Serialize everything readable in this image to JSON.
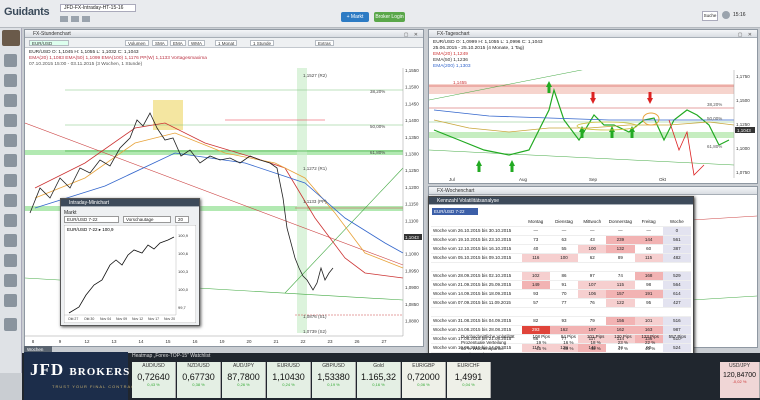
{
  "app": {
    "logo_text": "Guidants",
    "tab_title": "JFD-FX-Intraday-HT-15-16",
    "btn_markt": "+ Markt",
    "btn_broker": "Broker Login",
    "search": "Suche",
    "time": "15:16"
  },
  "main_chart": {
    "title": "FX-Stundenchart",
    "toolbar": [
      "Volumen",
      "SMA",
      "EMA",
      "WMA",
      "1 Monat",
      "1 Stunde",
      "Extras"
    ],
    "symbol_line": "EUR/USD  O: 1,1045  H: 1,1055  L: 1,1032  C: 1,1043",
    "ema_line": "EMA(20) 1,1083   EMA(50) 1,1099   EMA(100) 1,1176   PP(W) 1,1133   Vortagesmaxima",
    "date_line": "07.10.2015 15:00 - 03.11.2015 (3 Wochen, 1 Stunde)",
    "price_ticks": [
      "1,1550",
      "1,1500",
      "1,1450",
      "1,1400",
      "1,1350",
      "1,1300",
      "1,1250",
      "1,1200",
      "1,1150",
      "1,1100",
      "1,1050",
      "1,1000",
      "1,0950",
      "1,0900",
      "1,0850",
      "1,0800"
    ],
    "date_ticks": [
      "8",
      "9",
      "12",
      "13",
      "14",
      "15",
      "16",
      "19",
      "20",
      "21",
      "22",
      "23",
      "26",
      "27"
    ],
    "level_labels": [
      "1,1527 (R2)",
      "38,20%",
      "50,00%",
      "61,80%",
      "1,1272 (R1)",
      "1,1133 (PP)",
      "1,1043",
      "1,0876 (S1)",
      "1,0739 (S2)"
    ],
    "last_price": "1,1043"
  },
  "mini_chart": {
    "title": "Intraday-Minichart",
    "search_label": "Markt",
    "symbol": "EUR/USD 7-22",
    "dropdown": "Vorschautage",
    "days": "20",
    "header": "EUR/USD 7-22 ▸ 100,9",
    "ticks_y": [
      "100,9",
      "100,6",
      "100,3",
      "100,0",
      "99,7"
    ],
    "ticks_x": [
      "Okt 27",
      "Okt 30",
      "Nov 04",
      "Nov 09",
      "Nov 12",
      "Nov 17",
      "Nov 20"
    ]
  },
  "daily_chart": {
    "title": "FX-Tageschart",
    "symbol_line": "EUR/USD  O: 1,0999  H: 1,1055  L: 1,0996  C: 1,1043",
    "date_line": "25.06.2015 - 25.10.2015 (4 Monate, 1 Tag)",
    "ema20": "EMA(20) 1,1249",
    "ema50": "EMA(50) 1,1236",
    "ema200": "EMA(200) 1,1303",
    "level_455": "1,1455",
    "price_ticks": [
      "1,1750",
      "1,1500",
      "1,1250",
      "1,1000",
      "1,0750"
    ],
    "fib_labels": [
      "38,20%",
      "50,00%",
      "61,80%"
    ],
    "last_price": "1,1043",
    "months": [
      "Jul",
      "Aug",
      "Sep",
      "Okt"
    ]
  },
  "weekly": {
    "title": "FX-Wochenchart",
    "sub": "Kennzahl Volatilitätsanalyse",
    "symbol": "EUR/USD 7-22",
    "headers": [
      "Montag",
      "Dienstag",
      "Mittwoch",
      "Donnerstag",
      "Freitag",
      "Woche"
    ],
    "rows": [
      {
        "week": "Woche vom 26.10.2015 bis 30.10.2015",
        "v": [
          "—",
          "—",
          "—",
          "—",
          "—",
          "0"
        ]
      },
      {
        "week": "Woche vom 19.10.2015 bis 23.10.2015",
        "v": [
          "73",
          "63",
          "43",
          "239",
          "144",
          "561"
        ]
      },
      {
        "week": "Woche vom 12.10.2015 bis 16.10.2015",
        "v": [
          "40",
          "55",
          "100",
          "132",
          "60",
          "387"
        ]
      },
      {
        "week": "Woche vom 05.10.2015 bis 09.10.2015",
        "v": [
          "116",
          "100",
          "62",
          "89",
          "115",
          "482"
        ]
      },
      {
        "week": "",
        "v": [
          "",
          "",
          "",
          "",
          "",
          ""
        ]
      },
      {
        "week": "Woche vom 28.09.2015 bis 02.10.2015",
        "v": [
          "102",
          "86",
          "97",
          "74",
          "168",
          "529"
        ]
      },
      {
        "week": "Woche vom 21.09.2015 bis 25.09.2015",
        "v": [
          "149",
          "91",
          "107",
          "115",
          "98",
          "564"
        ]
      },
      {
        "week": "Woche vom 14.09.2015 bis 18.09.2015",
        "v": [
          "93",
          "70",
          "106",
          "157",
          "191",
          "614"
        ]
      },
      {
        "week": "Woche vom 07.09.2015 bis 11.09.2015",
        "v": [
          "57",
          "77",
          "76",
          "122",
          "95",
          "427"
        ]
      },
      {
        "week": "",
        "v": [
          "",
          "",
          "",
          "",
          "",
          ""
        ]
      },
      {
        "week": "Woche vom 31.08.2015 bis 04.09.2015",
        "v": [
          "82",
          "93",
          "79",
          "156",
          "101",
          "516"
        ]
      },
      {
        "week": "Woche vom 24.08.2015 bis 28.08.2015",
        "v": [
          "293",
          "162",
          "197",
          "162",
          "163",
          "987"
        ]
      },
      {
        "week": "Woche vom 17.08.2015 bis 21.08.2015",
        "v": [
          "66",
          "77",
          "117",
          "114",
          "136",
          "510"
        ]
      },
      {
        "week": "Woche vom 10.08.2015 bis 14.08.2015",
        "v": [
          "117",
          "128",
          "145",
          "74",
          "60",
          "524"
        ]
      }
    ],
    "summary": [
      {
        "label": "Durchschnittliche Volatilität",
        "v": [
          "108 Pips",
          "94 Pips",
          "101 Pips",
          "130 Pips",
          "123 Pips",
          "557 Pips"
        ]
      },
      {
        "label": "Prozentuale Verteilung",
        "v": [
          "19 %",
          "16 %",
          "18 %",
          "23 %",
          "22 %",
          ""
        ]
      },
      {
        "label": "50 % Wochenspanne",
        "v": [
          "45 %",
          "49 %",
          "46 %",
          "47 %",
          "40 %",
          ""
        ]
      },
      {
        "label": "Totale Wochenspanne",
        "v": [
          "47 %",
          "52 %",
          "50 %",
          "51 %",
          "50 %",
          ""
        ]
      }
    ]
  },
  "bottom": {
    "watch_label": "Wochen",
    "heatmap_title": "Heatmap „Forex-TOP-15“ Watchlist",
    "jfd": "JFD",
    "jfd2": "BROKERS",
    "jfd_sub": "TRUST YOUR FINAL CONTRACT",
    "tiles": [
      {
        "n": "AUD/USD",
        "v": "0,72640",
        "c": "0,43 %"
      },
      {
        "n": "NZD/USD",
        "v": "0,67730",
        "c": "0,38 %"
      },
      {
        "n": "AUD/JPY",
        "v": "87,7800",
        "c": "0,26 %"
      },
      {
        "n": "EUR/USD",
        "v": "1,10430",
        "c": "0,24 %"
      },
      {
        "n": "GBP/USD",
        "v": "1,53380",
        "c": "0,19 %"
      },
      {
        "n": "Gold",
        "v": "1.165,32",
        "c": "0,16 %"
      },
      {
        "n": "EUR/GBP",
        "v": "0,72000",
        "c": "0,06 %"
      },
      {
        "n": "EUR/CHF",
        "v": "1,4991",
        "c": "0,04 %"
      }
    ],
    "last_tile": {
      "n": "USD/JPY",
      "v": "120,84700",
      "c": "-0,02 %"
    }
  }
}
